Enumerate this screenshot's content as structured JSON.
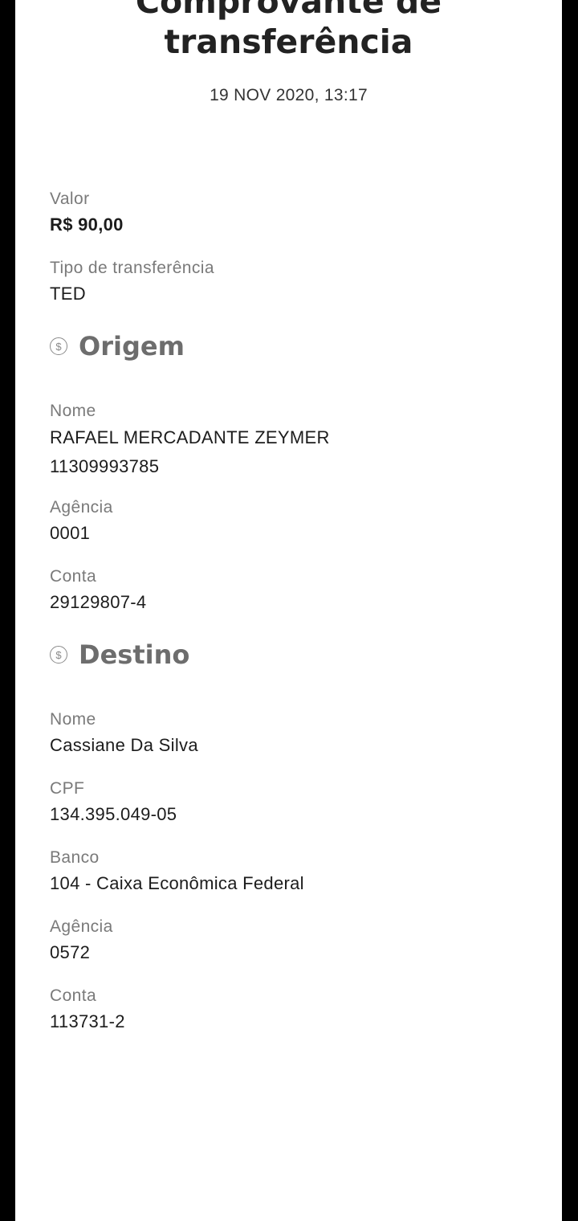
{
  "header": {
    "title_line1": "Comprovante de",
    "title_line2": "transferência",
    "date": "19 NOV 2020, 13:17"
  },
  "summary": {
    "valor_label": "Valor",
    "valor_value": "R$ 90,00",
    "tipo_label": "Tipo de transferência",
    "tipo_value": "TED"
  },
  "origem": {
    "section_title": "Origem",
    "icon": "dollar-circle-icon",
    "nome_label": "Nome",
    "nome_value": "RAFAEL MERCADANTE ZEYMER",
    "nome_doc": "11309993785",
    "agencia_label": "Agência",
    "agencia_value": "0001",
    "conta_label": "Conta",
    "conta_value": "29129807-4"
  },
  "destino": {
    "section_title": "Destino",
    "icon": "dollar-circle-icon",
    "nome_label": "Nome",
    "nome_value": "Cassiane Da Silva",
    "cpf_label": "CPF",
    "cpf_value": "134.395.049-05",
    "banco_label": "Banco",
    "banco_value": "104 - Caixa Econômica Federal",
    "agencia_label": "Agência",
    "agencia_value": "0572",
    "conta_label": "Conta",
    "conta_value": "113731-2"
  },
  "colors": {
    "background": "#ffffff",
    "frame": "#000000",
    "label": "#7a7a7a",
    "value": "#1c1c1c",
    "section_title": "#6d6d6d"
  }
}
